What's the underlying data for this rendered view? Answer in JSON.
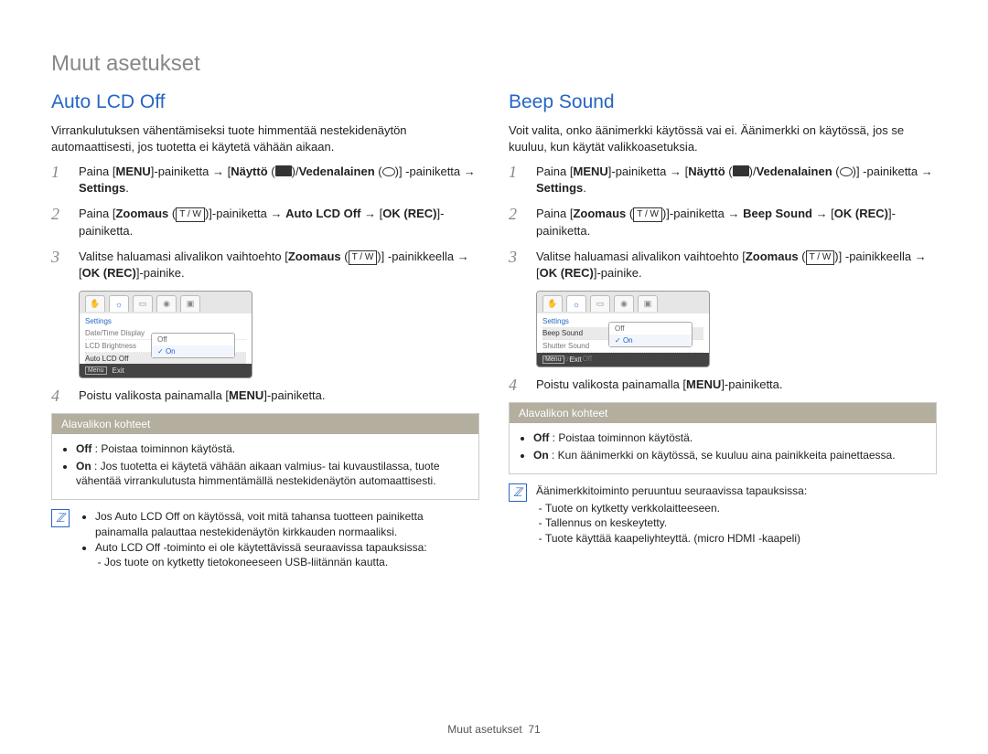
{
  "page_title": "Muut asetukset",
  "footer": {
    "section": "Muut asetukset",
    "page": "71"
  },
  "left": {
    "title": "Auto LCD Off",
    "intro": "Virrankulutuksen vähentämiseksi tuote himmentää nestekidenäytön automaattisesti, jos tuotetta ei käytetä vähään aikaan.",
    "steps": {
      "s1_a": "Paina [",
      "s1_menu": "MENU",
      "s1_b": "]-painiketta → [",
      "s1_display": "Näyttö",
      "s1_c": " (",
      "s1_d": ")/",
      "s1_uw": "Vedenalainen",
      "s1_e": " (",
      "s1_f": ")] -painiketta → ",
      "s1_settings": "Settings",
      "s1_g": ".",
      "s2_a": "Paina [",
      "s2_zoom": "Zoomaus",
      "s2_tw": "T / W",
      "s2_b": "]-painiketta → ",
      "s2_target": "Auto LCD Off",
      "s2_c": " → [",
      "s2_ok": "OK (REC)",
      "s2_d": "]-painiketta.",
      "s3_a": "Valitse haluamasi alivalikon vaihtoehto [",
      "s3_zoom": "Zoomaus",
      "s3_tw": "T / W",
      "s3_b": "] -painikkeella → [",
      "s3_ok": "OK (REC)",
      "s3_c": "]-painike.",
      "s4_a": "Poistu valikosta painamalla [",
      "s4_menu": "MENU",
      "s4_b": "]-painiketta."
    },
    "shot": {
      "settings": "Settings",
      "rows": [
        "Date/Time Display",
        "LCD Brightness",
        "Auto LCD Off"
      ],
      "popup": {
        "off": "Off",
        "on": "On"
      },
      "exit_key": "Menu",
      "exit": "Exit"
    },
    "subbox": {
      "header": "Alavalikon kohteet",
      "off_label": "Off",
      "off_text": " : Poistaa toiminnon käytöstä.",
      "on_label": "On",
      "on_text": " : Jos tuotetta ei käytetä vähään aikaan valmius- tai kuvaustilassa, tuote vähentää virrankulutusta himmentämällä nestekidenäytön automaattisesti."
    },
    "note": {
      "l1": "Jos Auto LCD Off on käytössä, voit mitä tahansa tuotteen painiketta painamalla palauttaa nestekidenäytön kirkkauden normaaliksi.",
      "l2": "Auto LCD Off -toiminto ei ole käytettävissä seuraavissa tapauksissa:",
      "l2a": "Jos tuote on kytketty tietokoneeseen USB-liitännän kautta."
    }
  },
  "right": {
    "title": "Beep Sound",
    "intro": "Voit valita, onko äänimerkki käytössä vai ei. Äänimerkki on käytössä, jos se kuuluu, kun käytät valikkoasetuksia.",
    "steps": {
      "s1_a": "Paina [",
      "s1_menu": "MENU",
      "s1_b": "]-painiketta → [",
      "s1_display": "Näyttö",
      "s1_c": " (",
      "s1_d": ")/",
      "s1_uw": "Vedenalainen",
      "s1_e": " (",
      "s1_f": ")] -painiketta → ",
      "s1_settings": "Settings",
      "s1_g": ".",
      "s2_a": "Paina [",
      "s2_zoom": "Zoomaus",
      "s2_tw": "T / W",
      "s2_b": "]-painiketta → ",
      "s2_target": "Beep Sound",
      "s2_c": " → [",
      "s2_ok": "OK (REC)",
      "s2_d": "]-painiketta.",
      "s3_a": "Valitse haluamasi alivalikon vaihtoehto [",
      "s3_zoom": "Zoomaus",
      "s3_tw": "T / W",
      "s3_b": "] -painikkeella → [",
      "s3_ok": "OK (REC)",
      "s3_c": "]-painike.",
      "s4_a": "Poistu valikosta painamalla [",
      "s4_menu": "MENU",
      "s4_b": "]-painiketta."
    },
    "shot": {
      "settings": "Settings",
      "rows": [
        "Beep Sound",
        "Shutter Sound",
        "Auto Power Off"
      ],
      "popup": {
        "off": "Off",
        "on": "On"
      },
      "exit_key": "Menu",
      "exit": "Exit"
    },
    "subbox": {
      "header": "Alavalikon kohteet",
      "off_label": "Off",
      "off_text": " : Poistaa toiminnon käytöstä.",
      "on_label": "On",
      "on_text": " : Kun äänimerkki on käytössä, se kuuluu aina painikkeita painettaessa."
    },
    "note": {
      "l1": "Äänimerkkitoiminto peruuntuu seuraavissa tapauksissa:",
      "l1a": "Tuote on kytketty verkkolaitteeseen.",
      "l1b": "Tallennus on keskeytetty.",
      "l1c": "Tuote käyttää kaapeliyhteyttä. (micro HDMI -kaapeli)"
    }
  }
}
